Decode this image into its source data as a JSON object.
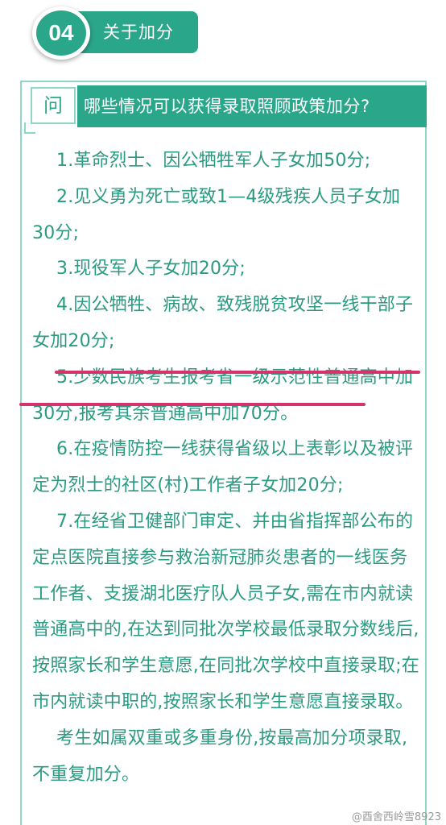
{
  "header": {
    "number": "04",
    "title": "关于加分"
  },
  "question": {
    "icon_char": "问",
    "text": "哪些情况可以获得录取照顾政策加分?"
  },
  "items": [
    "1.革命烈士、因公牺牲军人子女加50分;",
    "2.见义勇为死亡或致1—4级残疾人员子女加30分;",
    "3.现役军人子女加20分;",
    "4.因公牺牲、病故、致残脱贫攻坚一线干部子女加20分;",
    "5.少数民族考生报考省一级示范性普通高中加30分,报考其余普通高中加70分。",
    "6.在疫情防控一线获得省级以上表彰以及被评定为烈士的社区(村)工作者子女加20分;",
    "7.在经省卫健部门审定、并由省指挥部公布的定点医院直接参与救治新冠肺炎患者的一线医务工作者、支援湖北医疗队人员子女,需在市内就读普通高中的,在达到同批次学校最低录取分数线后,按照家长和学生意愿,在同批次学校中直接录取;在市内就读中职的,按照家长和学生意愿直接录取。"
  ],
  "note": "考生如属双重或多重身份,按最高加分项录取,不重复加分。",
  "watermark": "@酉舍西岭雪8923",
  "colors": {
    "accent": "#2aa68a",
    "border": "#8fd6c4",
    "highlight": "#d6336c",
    "text": "#2a9a80"
  }
}
